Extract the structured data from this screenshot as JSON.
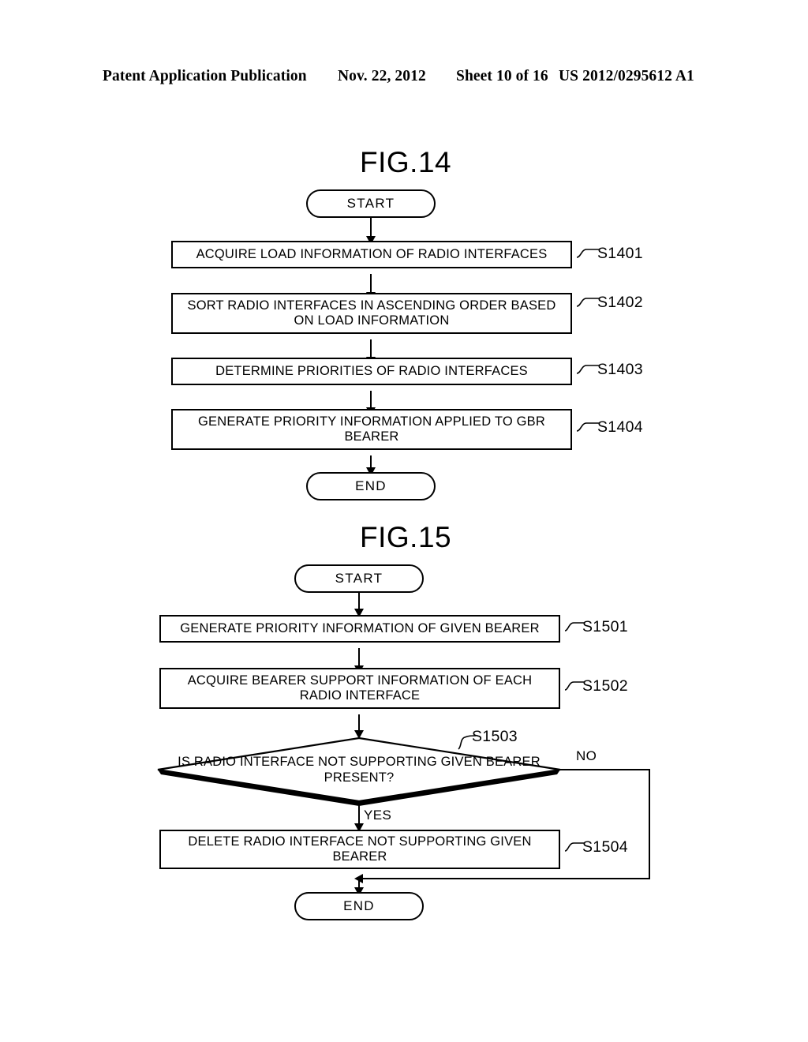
{
  "header": {
    "publication": "Patent Application Publication",
    "date": "Nov. 22, 2012",
    "sheet": "Sheet 10 of 16",
    "pub_number": "US 2012/0295612 A1"
  },
  "figures": [
    {
      "title": "FIG.14",
      "start_label": "START",
      "end_label": "END",
      "steps": [
        {
          "ref": "S1401",
          "text": "ACQUIRE LOAD INFORMATION OF RADIO INTERFACES"
        },
        {
          "ref": "S1402",
          "text": "SORT RADIO INTERFACES IN ASCENDING ORDER BASED ON LOAD INFORMATION"
        },
        {
          "ref": "S1403",
          "text": "DETERMINE PRIORITIES OF RADIO INTERFACES"
        },
        {
          "ref": "S1404",
          "text": "GENERATE PRIORITY INFORMATION APPLIED TO GBR BEARER"
        }
      ]
    },
    {
      "title": "FIG.15",
      "start_label": "START",
      "end_label": "END",
      "steps": [
        {
          "ref": "S1501",
          "text": "GENERATE PRIORITY INFORMATION OF GIVEN BEARER"
        },
        {
          "ref": "S1502",
          "text": "ACQUIRE BEARER SUPPORT INFORMATION OF EACH RADIO INTERFACE"
        },
        {
          "ref": "S1503",
          "text": "IS RADIO INTERFACE NOT SUPPORTING GIVEN BEARER PRESENT?"
        },
        {
          "ref": "S1504",
          "text": "DELETE RADIO INTERFACE NOT SUPPORTING GIVEN BEARER"
        }
      ],
      "branches": {
        "yes": "YES",
        "no": "NO"
      }
    }
  ],
  "colors": {
    "ink": "#000000",
    "paper": "#ffffff"
  }
}
